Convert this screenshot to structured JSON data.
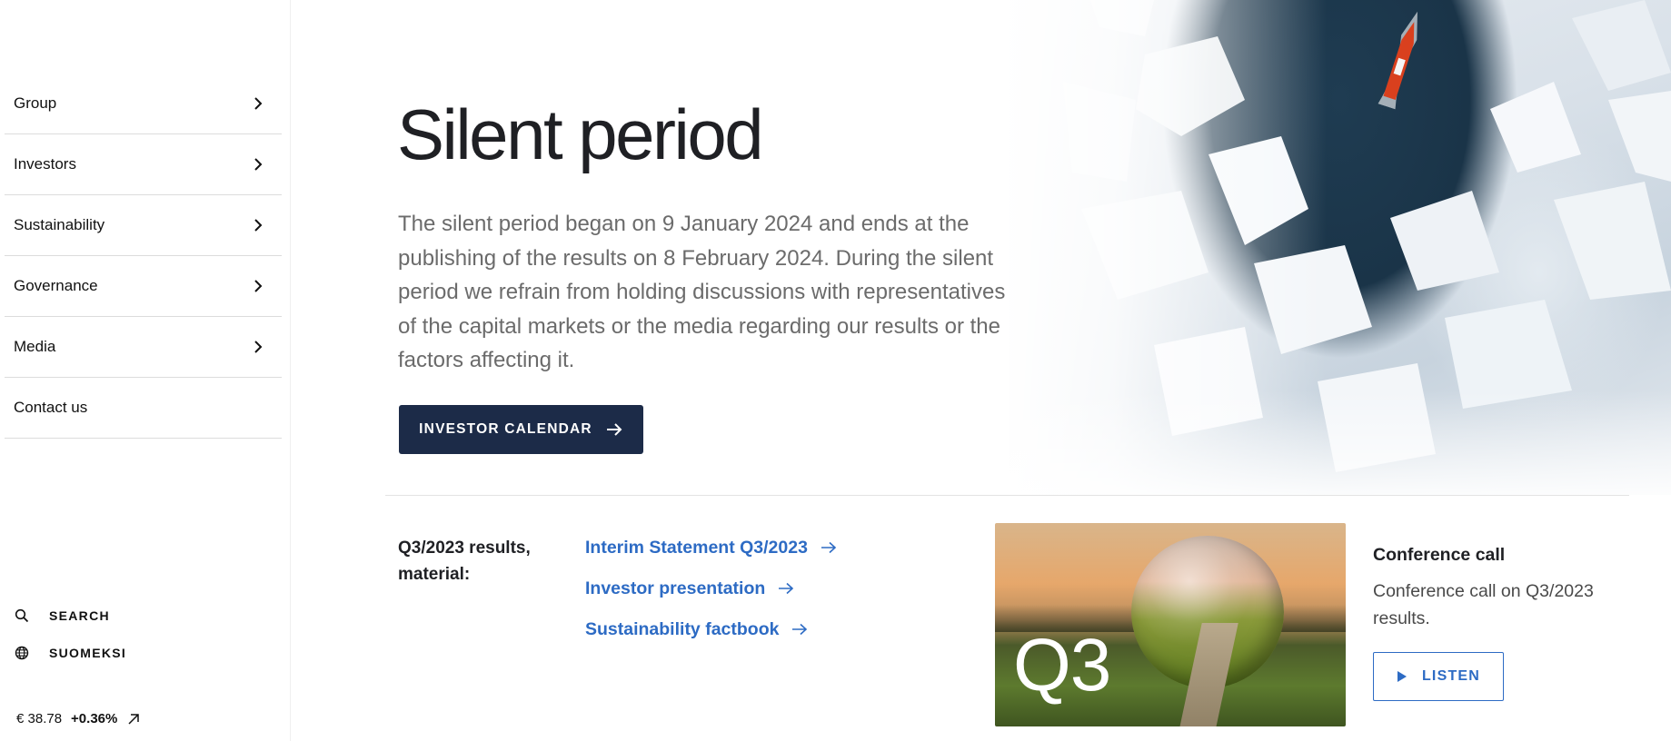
{
  "sidebar": {
    "nav_items": [
      {
        "label": "Group",
        "has_submenu": true
      },
      {
        "label": "Investors",
        "has_submenu": true
      },
      {
        "label": "Sustainability",
        "has_submenu": true
      },
      {
        "label": "Governance",
        "has_submenu": true
      },
      {
        "label": "Media",
        "has_submenu": true
      },
      {
        "label": "Contact us",
        "has_submenu": false
      }
    ],
    "search_label": "SEARCH",
    "search_icon": "search-icon",
    "language_label": "SUOMEKSI",
    "language_icon": "globe-icon",
    "stock": {
      "price": "€ 38.78",
      "change": "+0.36%",
      "link_icon": "external-arrow-icon"
    }
  },
  "main": {
    "title": "Silent period",
    "intro": "The silent period began on 9 January 2024 and ends at the publishing of the results on 8 February 2024. During the silent period we refrain from holding discussions with representatives of the capital markets or the media regarding our results or the factors affecting it.",
    "cta_label": "INVESTOR CALENDAR",
    "cta_icon": "arrow-right-icon"
  },
  "results": {
    "label": "Q3/2023 results, material:",
    "links": [
      {
        "label": "Interim Statement Q3/2023"
      },
      {
        "label": "Investor presentation"
      },
      {
        "label": "Sustainability factbook"
      }
    ],
    "image_text": "Q3",
    "conference": {
      "title": "Conference call",
      "description": "Conference call on Q3/2023 results.",
      "button_label": "LISTEN",
      "button_icon": "play-icon"
    }
  },
  "colors": {
    "primary_dark": "#1c2b48",
    "link_blue": "#2d6bc4",
    "text_dark": "#1f2024",
    "text_muted": "#6b6b6b"
  }
}
